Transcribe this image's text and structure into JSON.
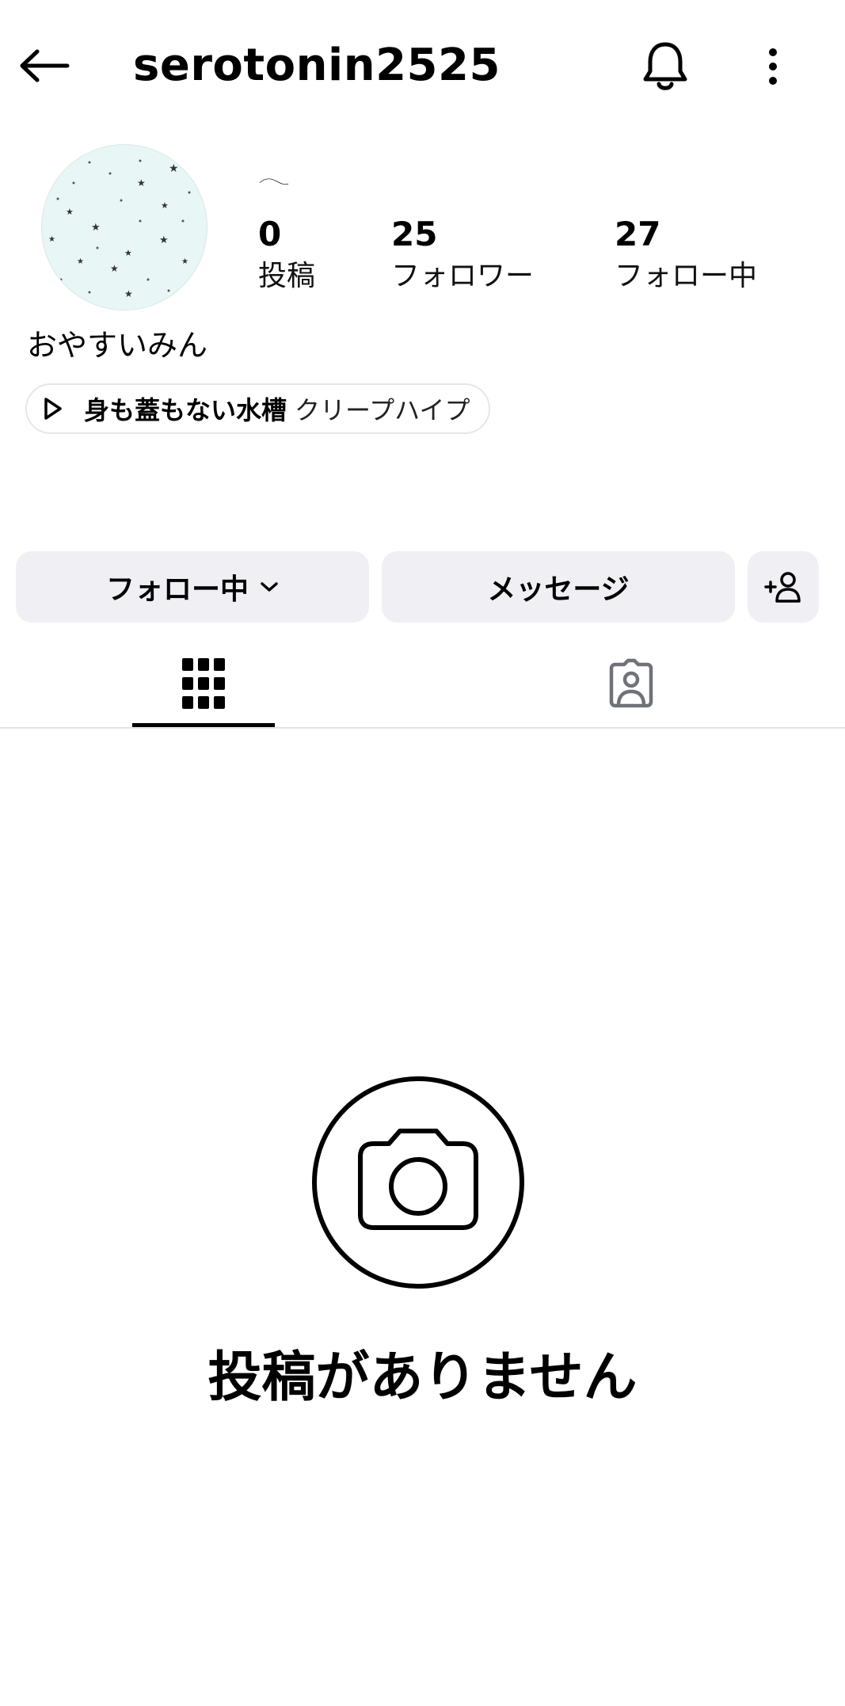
{
  "header": {
    "username": "serotonin2525",
    "back_icon": "arrow-left-icon",
    "bell_icon": "bell-icon",
    "more_icon": "more-vertical-icon"
  },
  "profile": {
    "display_name": "𓂃",
    "avatar_icon": "avatar-stars-pattern",
    "stats": {
      "posts_count": "0",
      "posts_label": "投稿",
      "followers_count": "25",
      "followers_label": "フォロワー",
      "following_count": "27",
      "following_label": "フォロー中"
    },
    "bio": "おやすいみん",
    "music": {
      "song": "身も蓋もない水槽",
      "artist": "クリープハイプ",
      "icon": "play-icon"
    }
  },
  "actions": {
    "follow_label": "フォロー中",
    "message_label": "メッセージ",
    "add_user_icon": "add-user-icon"
  },
  "tabs": [
    {
      "name": "posts-grid",
      "icon": "grid-icon",
      "active": true
    },
    {
      "name": "tagged",
      "icon": "tagged-person-icon",
      "active": false
    }
  ],
  "empty_state": {
    "icon": "camera-icon",
    "text": "投稿がありません"
  },
  "colors": {
    "background": "#ffffff",
    "button_bg": "#efeff4",
    "text": "#000000",
    "divider": "#e3e3e6",
    "avatar_bg": "#e8f6f6"
  }
}
